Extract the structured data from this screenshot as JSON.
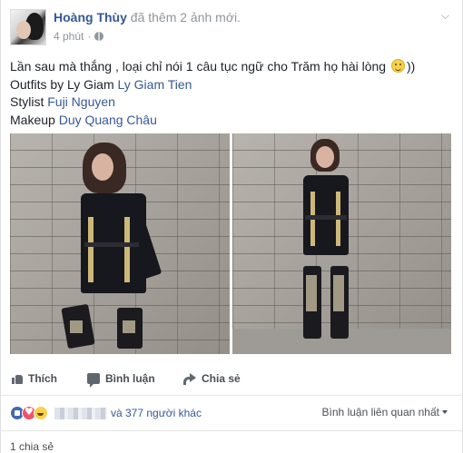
{
  "post": {
    "author": "Hoàng Thùy",
    "action": "đã thêm 2 ảnh mới.",
    "time": "4 phút",
    "privacy_icon": "globe-icon",
    "menu_icon": "chevron-down-icon",
    "text": {
      "line1": "Lần sau mà thắng , loại chỉ nói 1 câu tục ngữ cho Trăm họ hài lòng",
      "line1_suffix": "))",
      "line2_prefix": "Outfits by Ly Giam ",
      "line2_link": "Ly Giam Tien",
      "line3_prefix": "Stylist ",
      "line3_link": "Fuji Nguyen",
      "line4_prefix": "Makeup ",
      "line4_link": "Duy Quang Châu"
    },
    "photo_count": 2
  },
  "actions": {
    "like": "Thích",
    "comment": "Bình luận",
    "share": "Chia sẻ"
  },
  "reactions": {
    "types": [
      "like",
      "love",
      "haha"
    ],
    "others": "và 377 người khác"
  },
  "comment_sort": "Bình luận liên quan nhất",
  "shares": "1 chia sẻ",
  "colors": {
    "link": "#365899",
    "muted": "#90949c",
    "text": "#1d2129"
  }
}
